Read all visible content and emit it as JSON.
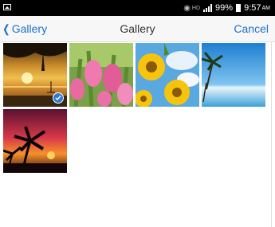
{
  "status_bar": {
    "battery": "99%",
    "time": "9:57",
    "ampm": "AM",
    "network": "HD",
    "icons": [
      "image-icon",
      "wifi-icon",
      "signal-icon",
      "battery-icon"
    ]
  },
  "header": {
    "back_label": "Gallery",
    "title": "Gallery",
    "cancel_label": "Cancel"
  },
  "photos": [
    {
      "name": "sunset-sailboat",
      "selected": true
    },
    {
      "name": "pink-tulips",
      "selected": false
    },
    {
      "name": "sunflowers",
      "selected": false
    },
    {
      "name": "palm-beach",
      "selected": false
    },
    {
      "name": "palm-sunset",
      "selected": false
    }
  ],
  "colors": {
    "accent": "#1a73c8",
    "check": "#2e7bd6"
  }
}
